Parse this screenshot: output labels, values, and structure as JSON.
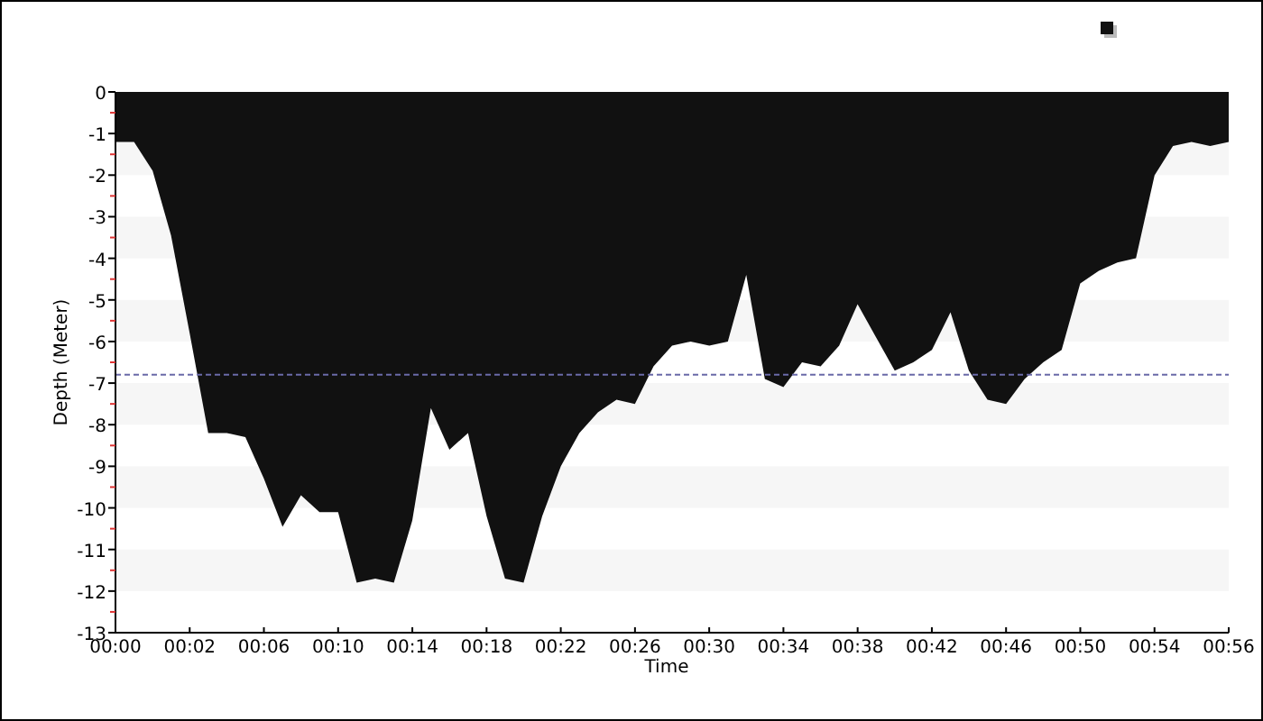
{
  "chart": {
    "chart_data": {
      "type": "area",
      "xlabel": "Time",
      "ylabel": "Depth (Meter)",
      "ylim": [
        -13,
        0
      ],
      "yticks": [
        0,
        -1,
        -2,
        -3,
        -4,
        -5,
        -6,
        -7,
        -8,
        -9,
        -10,
        -11,
        -12,
        -13
      ],
      "categories": [
        "00:00",
        null,
        null,
        null,
        "00:02",
        null,
        null,
        null,
        "00:06",
        null,
        null,
        null,
        "00:10",
        null,
        null,
        null,
        "00:14",
        null,
        null,
        null,
        "00:18",
        null,
        null,
        null,
        "00:22",
        null,
        null,
        null,
        "00:26",
        null,
        null,
        null,
        "00:30",
        null,
        null,
        null,
        "00:34",
        null,
        null,
        null,
        "00:38",
        null,
        null,
        null,
        "00:42",
        null,
        null,
        null,
        "00:46",
        null,
        null,
        null,
        "00:50",
        null,
        null,
        null,
        "00:54",
        null,
        null,
        null,
        "00:56"
      ],
      "series": [
        {
          "color": "#111111",
          "values": [
            -1.2,
            -1.2,
            -1.9,
            -3.45,
            -5.8,
            -8.2,
            -8.2,
            -8.3,
            -9.3,
            -10.45,
            -9.7,
            -10.1,
            -10.1,
            -11.8,
            -11.7,
            -11.8,
            -10.3,
            -7.6,
            -8.6,
            -8.2,
            -10.2,
            -11.7,
            -11.8,
            -10.2,
            -9.0,
            -8.2,
            -7.7,
            -7.4,
            -7.5,
            -6.6,
            -6.1,
            -6.0,
            -6.1,
            -6.0,
            -4.4,
            -6.9,
            -7.1,
            -6.5,
            -6.6,
            -6.1,
            -5.1,
            -5.9,
            -6.7,
            -6.5,
            -6.2,
            -5.3,
            -6.7,
            -7.4,
            -7.5,
            -6.9,
            -6.5,
            -6.2,
            -4.6,
            -4.3,
            -4.1,
            -4.0,
            -2.0,
            -1.3,
            -1.2,
            -1.3,
            -1.2
          ]
        }
      ],
      "ref_lines": [
        {
          "axis": "y",
          "value": -6.8
        }
      ]
    }
  }
}
